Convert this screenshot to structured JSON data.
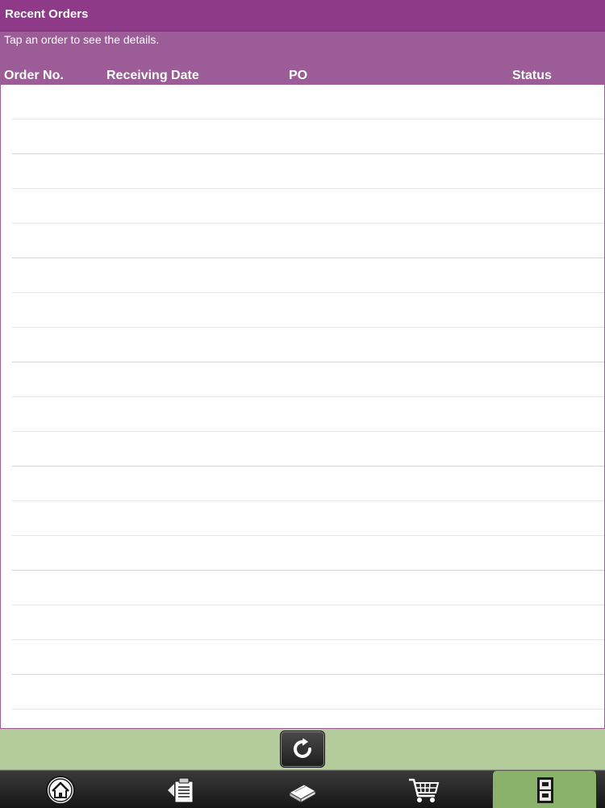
{
  "header": {
    "title": "Recent Orders",
    "hint": "Tap an order to see the details."
  },
  "table": {
    "columns": [
      "Order No.",
      "Receiving Date",
      "PO",
      "Status"
    ],
    "rows": []
  },
  "toolbar": {
    "refresh_icon": "refresh-icon"
  },
  "tabbar": {
    "tabs": [
      {
        "icon": "home-icon",
        "active": false
      },
      {
        "icon": "orders-clipboard-icon",
        "active": false
      },
      {
        "icon": "catalog-book-icon",
        "active": false
      },
      {
        "icon": "cart-icon",
        "active": false
      },
      {
        "icon": "recent-orders-icon",
        "active": true
      }
    ]
  },
  "colors": {
    "header": "#8e3a88",
    "subheader": "#9c5c97",
    "refresh_bar": "#b4cc9c",
    "active_tab": "#8bb26a"
  }
}
